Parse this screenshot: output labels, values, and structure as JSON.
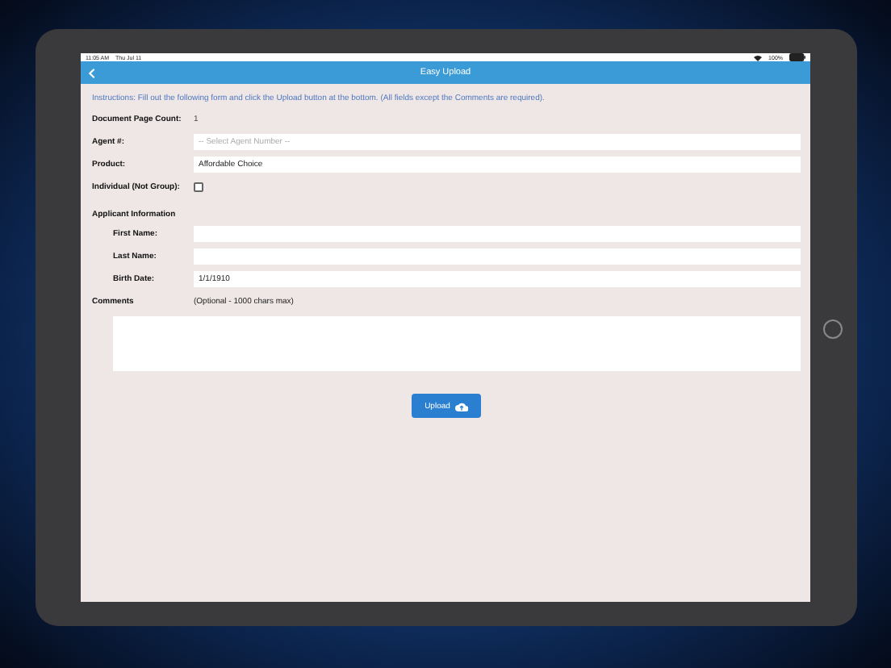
{
  "status_bar": {
    "time": "11:05 AM",
    "date": "Thu Jul 11",
    "battery": "100%"
  },
  "nav_bar": {
    "title": "Easy Upload"
  },
  "instructions": "Instructions: Fill out the following form and click the Upload button at the bottom. (All fields except the Comments are required).",
  "form": [
    {
      "kind": "info",
      "label": "Document Page Count:",
      "value": "1"
    },
    {
      "kind": "select",
      "label": "Agent #:",
      "placeholder": "-- Select Agent Number --"
    },
    {
      "kind": "input",
      "label": "Product:",
      "value": "Affordable Choice"
    },
    {
      "kind": "checkbox",
      "label": "Individual (Not Group):",
      "checked": false
    },
    {
      "kind": "section",
      "label": "Applicant Information",
      "children": [
        {
          "kind": "input",
          "label": "First Name:"
        },
        {
          "kind": "input",
          "label": "Last Name:"
        },
        {
          "kind": "input",
          "label": "Birth Date:",
          "value": "1/1/1910"
        }
      ]
    },
    {
      "kind": "textarea",
      "label": "Comments",
      "hint": "(Optional - 1000 chars max)"
    }
  ],
  "upload_button": {
    "label": "Upload"
  }
}
